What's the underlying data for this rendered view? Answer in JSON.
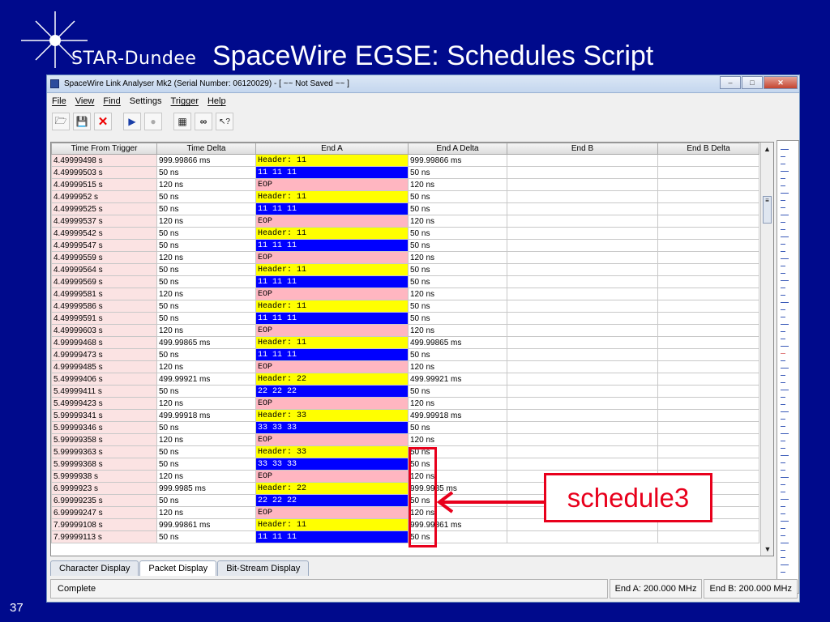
{
  "slide": {
    "title": "SpaceWire EGSE: Schedules Script",
    "logo_text": "STAR-Dundee",
    "number": "37"
  },
  "window": {
    "title": "SpaceWire Link Analyser Mk2 (Serial Number: 06120029) - [ ~~ Not Saved ~~ ]"
  },
  "menu": [
    "File",
    "View",
    "Find",
    "Settings",
    "Trigger",
    "Help"
  ],
  "toolbar_icons": [
    "open-icon",
    "save-icon",
    "delete-icon",
    "play-icon",
    "stop-icon",
    "calculator-icon",
    "binoculars-icon",
    "help-pointer-icon"
  ],
  "table": {
    "columns": [
      "Time From Trigger",
      "Time Delta",
      "End A",
      "End A Delta",
      "End B",
      "End B Delta"
    ],
    "rows": [
      {
        "t": "4.49999498 s",
        "d": "999.99866 ms",
        "a": "Header: 11",
        "k": "hdr",
        "ad": "999.99866 ms"
      },
      {
        "t": "4.49999503 s",
        "d": "50 ns",
        "a": "11 11 11",
        "k": "dat",
        "ad": "50 ns"
      },
      {
        "t": "4.49999515 s",
        "d": "120 ns",
        "a": "EOP",
        "k": "eop",
        "ad": "120 ns"
      },
      {
        "t": "4.4999952 s",
        "d": "50 ns",
        "a": "Header: 11",
        "k": "hdr",
        "ad": "50 ns"
      },
      {
        "t": "4.49999525 s",
        "d": "50 ns",
        "a": "11 11 11",
        "k": "dat",
        "ad": "50 ns"
      },
      {
        "t": "4.49999537 s",
        "d": "120 ns",
        "a": "EOP",
        "k": "eop",
        "ad": "120 ns"
      },
      {
        "t": "4.49999542 s",
        "d": "50 ns",
        "a": "Header: 11",
        "k": "hdr",
        "ad": "50 ns"
      },
      {
        "t": "4.49999547 s",
        "d": "50 ns",
        "a": "11 11 11",
        "k": "dat",
        "ad": "50 ns"
      },
      {
        "t": "4.49999559 s",
        "d": "120 ns",
        "a": "EOP",
        "k": "eop",
        "ad": "120 ns"
      },
      {
        "t": "4.49999564 s",
        "d": "50 ns",
        "a": "Header: 11",
        "k": "hdr",
        "ad": "50 ns"
      },
      {
        "t": "4.49999569 s",
        "d": "50 ns",
        "a": "11 11 11",
        "k": "dat",
        "ad": "50 ns"
      },
      {
        "t": "4.49999581 s",
        "d": "120 ns",
        "a": "EOP",
        "k": "eop",
        "ad": "120 ns"
      },
      {
        "t": "4.49999586 s",
        "d": "50 ns",
        "a": "Header: 11",
        "k": "hdr",
        "ad": "50 ns"
      },
      {
        "t": "4.49999591 s",
        "d": "50 ns",
        "a": "11 11 11",
        "k": "dat",
        "ad": "50 ns"
      },
      {
        "t": "4.49999603 s",
        "d": "120 ns",
        "a": "EOP",
        "k": "eop",
        "ad": "120 ns"
      },
      {
        "t": "4.99999468 s",
        "d": "499.99865 ms",
        "a": "Header: 11",
        "k": "hdr",
        "ad": "499.99865 ms"
      },
      {
        "t": "4.99999473 s",
        "d": "50 ns",
        "a": "11 11 11",
        "k": "dat",
        "ad": "50 ns"
      },
      {
        "t": "4.99999485 s",
        "d": "120 ns",
        "a": "EOP",
        "k": "eop",
        "ad": "120 ns"
      },
      {
        "t": "5.49999406 s",
        "d": "499.99921 ms",
        "a": "Header: 22",
        "k": "hdr",
        "ad": "499.99921 ms"
      },
      {
        "t": "5.49999411 s",
        "d": "50 ns",
        "a": "22 22 22",
        "k": "dat",
        "ad": "50 ns"
      },
      {
        "t": "5.49999423 s",
        "d": "120 ns",
        "a": "EOP",
        "k": "eop",
        "ad": "120 ns"
      },
      {
        "t": "5.99999341 s",
        "d": "499.99918 ms",
        "a": "Header: 33",
        "k": "hdr",
        "ad": "499.99918 ms"
      },
      {
        "t": "5.99999346 s",
        "d": "50 ns",
        "a": "33 33 33",
        "k": "dat",
        "ad": "50 ns"
      },
      {
        "t": "5.99999358 s",
        "d": "120 ns",
        "a": "EOP",
        "k": "eop",
        "ad": "120 ns"
      },
      {
        "t": "5.99999363 s",
        "d": "50 ns",
        "a": "Header: 33",
        "k": "hdr",
        "ad": "50 ns"
      },
      {
        "t": "5.99999368 s",
        "d": "50 ns",
        "a": "33 33 33",
        "k": "dat",
        "ad": "50 ns"
      },
      {
        "t": "5.9999938 s",
        "d": "120 ns",
        "a": "EOP",
        "k": "eop",
        "ad": "120 ns"
      },
      {
        "t": "6.9999923 s",
        "d": "999.9985 ms",
        "a": "Header: 22",
        "k": "hdr",
        "ad": "999.9985 ms"
      },
      {
        "t": "6.99999235 s",
        "d": "50 ns",
        "a": "22 22 22",
        "k": "dat",
        "ad": "50 ns"
      },
      {
        "t": "6.99999247 s",
        "d": "120 ns",
        "a": "EOP",
        "k": "eop",
        "ad": "120 ns"
      },
      {
        "t": "7.99999108 s",
        "d": "999.99861 ms",
        "a": "Header: 11",
        "k": "hdr",
        "ad": "999.99861 ms"
      },
      {
        "t": "7.99999113 s",
        "d": "50 ns",
        "a": "11 11 11",
        "k": "dat",
        "ad": "50 ns"
      }
    ]
  },
  "tabs": [
    "Character Display",
    "Packet Display",
    "Bit-Stream Display"
  ],
  "active_tab": "Packet Display",
  "status": {
    "main": "Complete",
    "end_a": "End A: 200.000 MHz",
    "end_b": "End B: 200.000 MHz"
  },
  "annotation": {
    "label": "schedule3",
    "color": "#e8001c"
  },
  "colors": {
    "background": "#000a8c",
    "header_cell": "#ffff00",
    "data_cell": "#0000ff",
    "eop_cell": "#ffb6c1",
    "time_cell": "#fbe3e3"
  }
}
